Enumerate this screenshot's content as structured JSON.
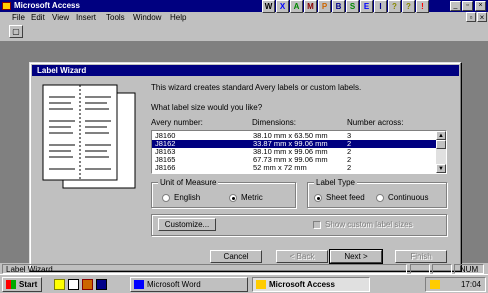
{
  "app": {
    "title": "Microsoft Access",
    "menu": [
      "File",
      "Edit",
      "View",
      "Insert",
      "Tools",
      "Window",
      "Help"
    ],
    "office_bar_icons": [
      "W",
      "X",
      "A",
      "M",
      "P",
      "B",
      "S",
      "E",
      "I",
      "?",
      "?",
      "!"
    ],
    "window_controls": {
      "minimize": "_",
      "restore": "▫",
      "close": "×"
    }
  },
  "dialog": {
    "title": "Label Wizard",
    "intro": "This wizard creates standard Avery labels or custom labels.",
    "question": "What label size would you like?",
    "columns": [
      "Avery number:",
      "Dimensions:",
      "Number across:"
    ],
    "rows": [
      {
        "avery": "J8160",
        "dims": "38.10 mm x 63.50 mm",
        "across": "3",
        "selected": false
      },
      {
        "avery": "J8162",
        "dims": "33.87 mm x 99.06 mm",
        "across": "2",
        "selected": true
      },
      {
        "avery": "J8163",
        "dims": "38.10 mm x 99.06 mm",
        "across": "2",
        "selected": false
      },
      {
        "avery": "J8165",
        "dims": "67.73 mm x 99.06 mm",
        "across": "2",
        "selected": false
      },
      {
        "avery": "J8166",
        "dims": "52 mm x 72 mm",
        "across": "2",
        "selected": false
      }
    ],
    "unit_group": {
      "label": "Unit of Measure",
      "options": [
        "English",
        "Metric"
      ],
      "selected": "Metric"
    },
    "type_group": {
      "label": "Label Type",
      "options": [
        "Sheet feed",
        "Continuous"
      ],
      "selected": "Sheet feed"
    },
    "customize_label": "Customize...",
    "show_custom_label": "Show custom label sizes",
    "buttons": {
      "cancel": "Cancel",
      "back": "< Back",
      "next": "Next >",
      "finish": "Finish"
    }
  },
  "status": {
    "text": "Label Wizard",
    "num": "NUM"
  },
  "taskbar": {
    "start": "Start",
    "tasks": [
      {
        "label": "Microsoft Word",
        "active": false
      },
      {
        "label": "Microsoft Access",
        "active": true
      }
    ],
    "clock": "17:04"
  },
  "colors": {
    "titlebar": "#000080",
    "selection": "#000080",
    "desktop": "#808080",
    "face": "#c0c0c0"
  }
}
